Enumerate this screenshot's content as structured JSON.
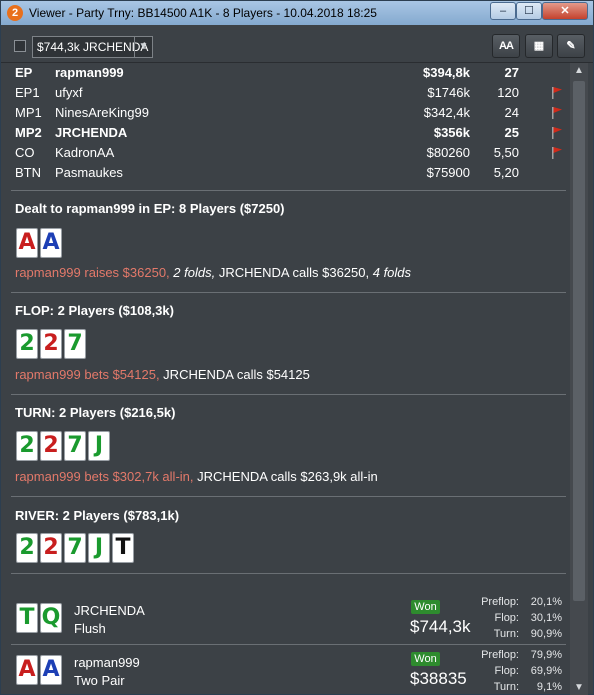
{
  "window": {
    "title": "Viewer - Party Trny: BB14500 A1K - 8 Players - 10.04.2018 18:25",
    "app_icon_glyph": "2",
    "minimize_glyph": "‒",
    "maximize_glyph": "☐",
    "close_glyph": "✕"
  },
  "toolbar": {
    "hand_select_value": "$744,3k JRCHENDA",
    "dropdown_glyph": "▼",
    "font_button_label": "AA",
    "grid_icon": "grid-icon",
    "grid_glyph": "▦",
    "edit_icon": "pencil-icon",
    "edit_glyph": "✎"
  },
  "seats": [
    {
      "pos": "EP",
      "name": "rapman999",
      "stack": "$394,8k",
      "bb": "27",
      "hero": true,
      "flag": false
    },
    {
      "pos": "EP1",
      "name": "ufyxf",
      "stack": "$1746k",
      "bb": "120",
      "hero": false,
      "flag": true
    },
    {
      "pos": "MP1",
      "name": "NinesAreKing99",
      "stack": "$342,4k",
      "bb": "24",
      "hero": false,
      "flag": true
    },
    {
      "pos": "MP2",
      "name": "JRCHENDA",
      "stack": "$356k",
      "bb": "25",
      "hero": true,
      "flag": true
    },
    {
      "pos": "CO",
      "name": "KadronAA",
      "stack": "$80260",
      "bb": "5,50",
      "hero": false,
      "flag": true
    },
    {
      "pos": "BTN",
      "name": "Pasmaukes",
      "stack": "$75900",
      "bb": "5,20",
      "hero": false,
      "flag": false
    }
  ],
  "preflop": {
    "header": "Dealt to rapman999 in EP: 8 Players ($7250)",
    "cards": [
      {
        "rank": "A",
        "suit": "h"
      },
      {
        "rank": "A",
        "suit": "d"
      }
    ],
    "action_hero": "rapman999 raises $36250,",
    "action_folds1": " 2 folds,",
    "action_call": " JRCHENDA calls $36250,",
    "action_folds2": " 4 folds"
  },
  "flop": {
    "header": "FLOP: 2 Players ($108,3k)",
    "cards": [
      {
        "rank": "2",
        "suit": "c"
      },
      {
        "rank": "2",
        "suit": "h"
      },
      {
        "rank": "7",
        "suit": "c"
      }
    ],
    "action_hero": "rapman999 bets $54125,",
    "action_call": " JRCHENDA calls $54125"
  },
  "turn": {
    "header": "TURN: 2 Players ($216,5k)",
    "cards": [
      {
        "rank": "2",
        "suit": "c"
      },
      {
        "rank": "2",
        "suit": "h"
      },
      {
        "rank": "7",
        "suit": "c"
      },
      {
        "rank": "J",
        "suit": "c"
      }
    ],
    "action_hero": "rapman999 bets $302,7k all-in,",
    "action_call": " JRCHENDA calls $263,9k all-in"
  },
  "river": {
    "header": "RIVER: 2 Players ($783,1k)",
    "cards": [
      {
        "rank": "2",
        "suit": "c"
      },
      {
        "rank": "2",
        "suit": "h"
      },
      {
        "rank": "7",
        "suit": "c"
      },
      {
        "rank": "J",
        "suit": "c"
      },
      {
        "rank": "T",
        "suit": "s"
      }
    ]
  },
  "results": [
    {
      "cards": [
        {
          "rank": "T",
          "suit": "c"
        },
        {
          "rank": "Q",
          "suit": "c"
        }
      ],
      "name": "JRCHENDA",
      "hand": "Flush",
      "badge": "Won",
      "amount": "$744,3k",
      "equity": [
        {
          "label": "Preflop:",
          "value": "20,1%"
        },
        {
          "label": "Flop:",
          "value": "30,1%"
        },
        {
          "label": "Turn:",
          "value": "90,9%"
        }
      ]
    },
    {
      "cards": [
        {
          "rank": "A",
          "suit": "h"
        },
        {
          "rank": "A",
          "suit": "d"
        }
      ],
      "name": "rapman999",
      "hand": "Two Pair",
      "badge": "Won",
      "amount": "$38835",
      "equity": [
        {
          "label": "Preflop:",
          "value": "79,9%"
        },
        {
          "label": "Flop:",
          "value": "69,9%"
        },
        {
          "label": "Turn:",
          "value": "9,1%"
        }
      ]
    }
  ],
  "scrollbar": {
    "up_glyph": "▲",
    "down_glyph": "▼"
  },
  "colors": {
    "hero_action": "#e3796a",
    "won_badge": "#2e8b2e",
    "flag": "#d02a1a"
  }
}
